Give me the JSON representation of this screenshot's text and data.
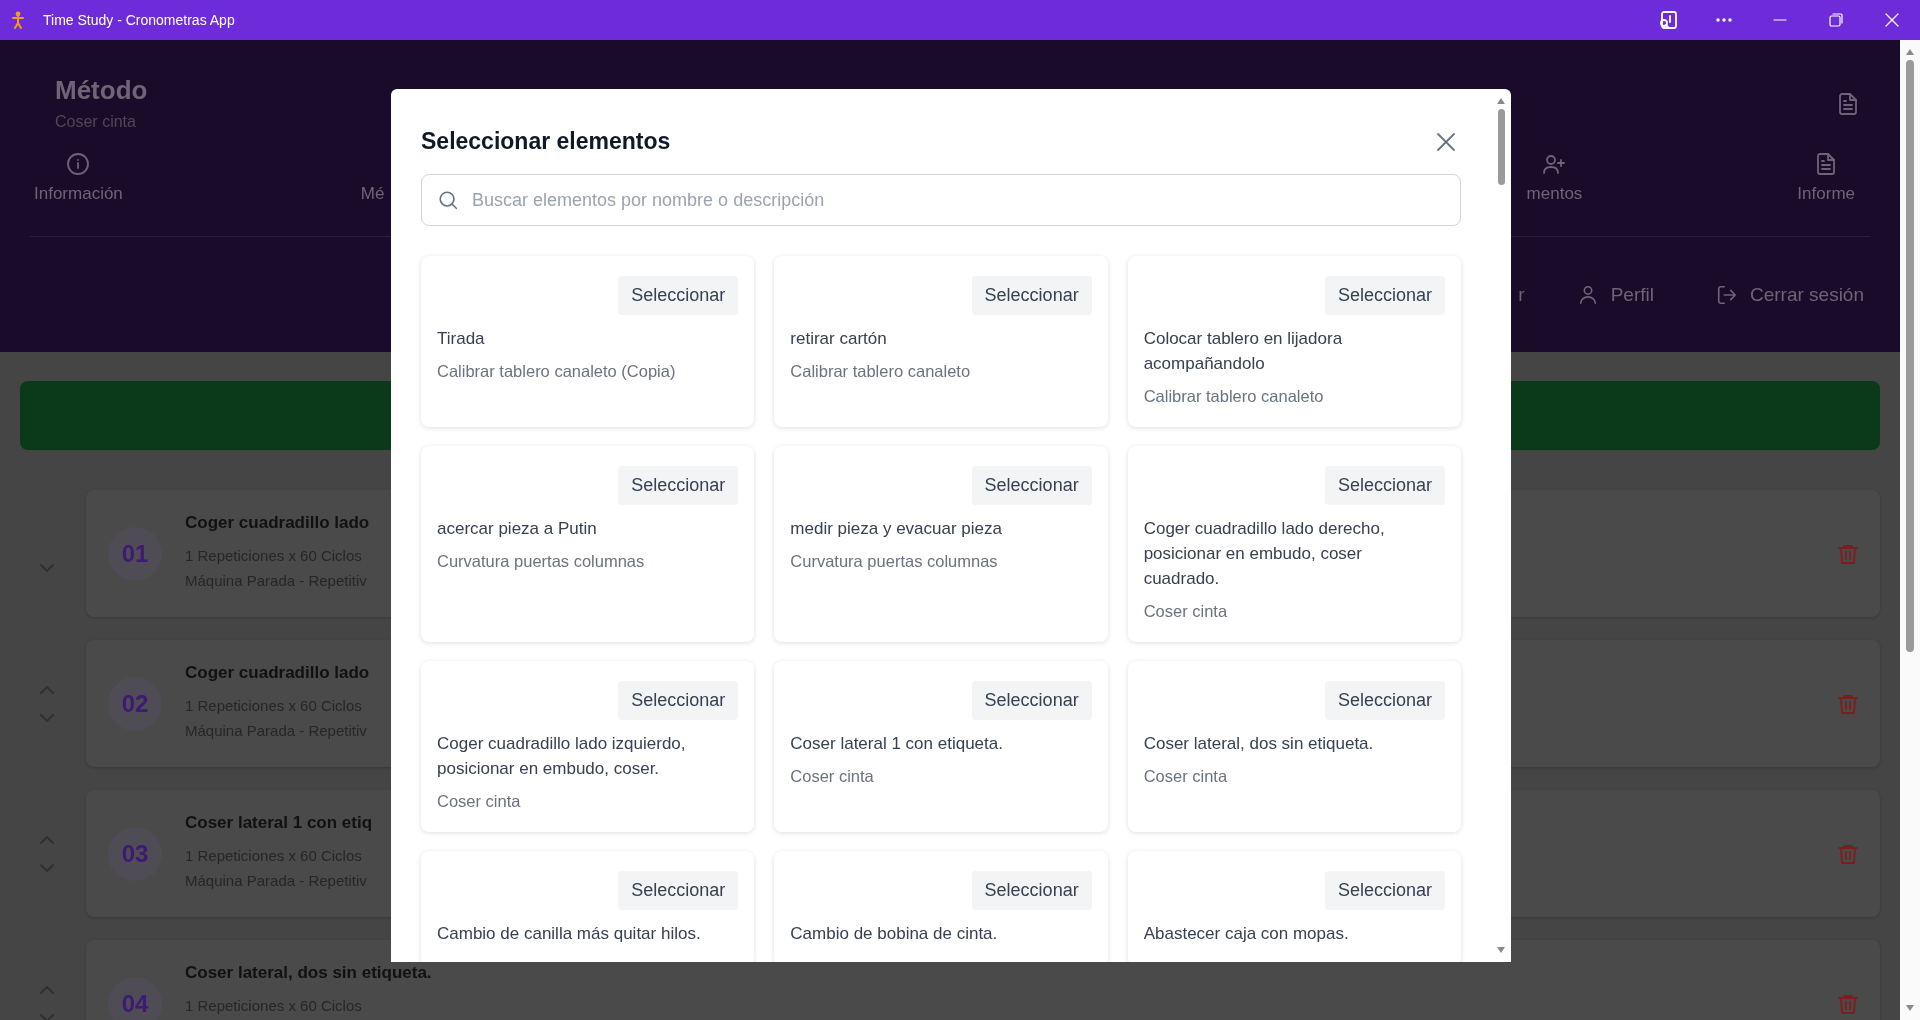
{
  "window": {
    "title": "Time Study - Cronometras App"
  },
  "header": {
    "title": "Método",
    "subtitle": "Coser cinta",
    "tabs": [
      {
        "label": "Información"
      },
      {
        "label": "Mé"
      },
      {
        "label": "mentos"
      },
      {
        "label": "Informe"
      }
    ],
    "nav_links": [
      {
        "label": "r"
      },
      {
        "label": "Perfil"
      },
      {
        "label": "Cerrar sesión"
      }
    ]
  },
  "element_rows": [
    {
      "number": "01",
      "title": "Coger cuadradillo lado",
      "detail": "1 Repeticiones x 60 Ciclos",
      "type": "Máquina Parada - Repetitiv",
      "can_move_up": false
    },
    {
      "number": "02",
      "title": "Coger cuadradillo lado",
      "detail": "1 Repeticiones x 60 Ciclos",
      "type": "Máquina Parada - Repetitiv",
      "can_move_up": true
    },
    {
      "number": "03",
      "title": "Coser lateral 1 con etiq",
      "detail": "1 Repeticiones x 60 Ciclos",
      "type": "Máquina Parada - Repetitiv",
      "can_move_up": true
    },
    {
      "number": "04",
      "title": "Coser lateral, dos sin etiqueta.",
      "detail": "1 Repeticiones x 60 Ciclos",
      "can_move_up": true
    }
  ],
  "dialog": {
    "title": "Seleccionar elementos",
    "search": {
      "placeholder": "Buscar elementos por nombre o descripción"
    },
    "cards": [
      {
        "title": "Tirada",
        "study": "Calibrar tablero canaleto (Copia)",
        "button": "Seleccionar"
      },
      {
        "title": "retirar cartón",
        "study": "Calibrar tablero canaleto",
        "button": "Seleccionar"
      },
      {
        "title": "Colocar tablero en lijadora acompañandolo",
        "study": "Calibrar tablero canaleto",
        "button": "Seleccionar"
      },
      {
        "title": "acercar pieza a Putin",
        "study": "Curvatura puertas columnas",
        "button": "Seleccionar"
      },
      {
        "title": "medir pieza y evacuar pieza",
        "study": "Curvatura puertas columnas",
        "button": "Seleccionar"
      },
      {
        "title": "Coger cuadradillo lado derecho, posicionar en embudo, coser cuadrado.",
        "study": "Coser cinta",
        "button": "Seleccionar"
      },
      {
        "title": "Coger cuadradillo lado izquierdo, posicionar en embudo, coser.",
        "study": "Coser cinta",
        "button": "Seleccionar"
      },
      {
        "title": "Coser lateral 1 con etiqueta.",
        "study": "Coser cinta",
        "button": "Seleccionar"
      },
      {
        "title": "Coser lateral, dos sin etiqueta.",
        "study": "Coser cinta",
        "button": "Seleccionar"
      },
      {
        "title": "Cambio de canilla más quitar hilos.",
        "button": "Seleccionar"
      },
      {
        "title": "Cambio de bobina de cinta.",
        "button": "Seleccionar"
      },
      {
        "title": "Abastecer caja con mopas.",
        "button": "Seleccionar"
      }
    ]
  }
}
